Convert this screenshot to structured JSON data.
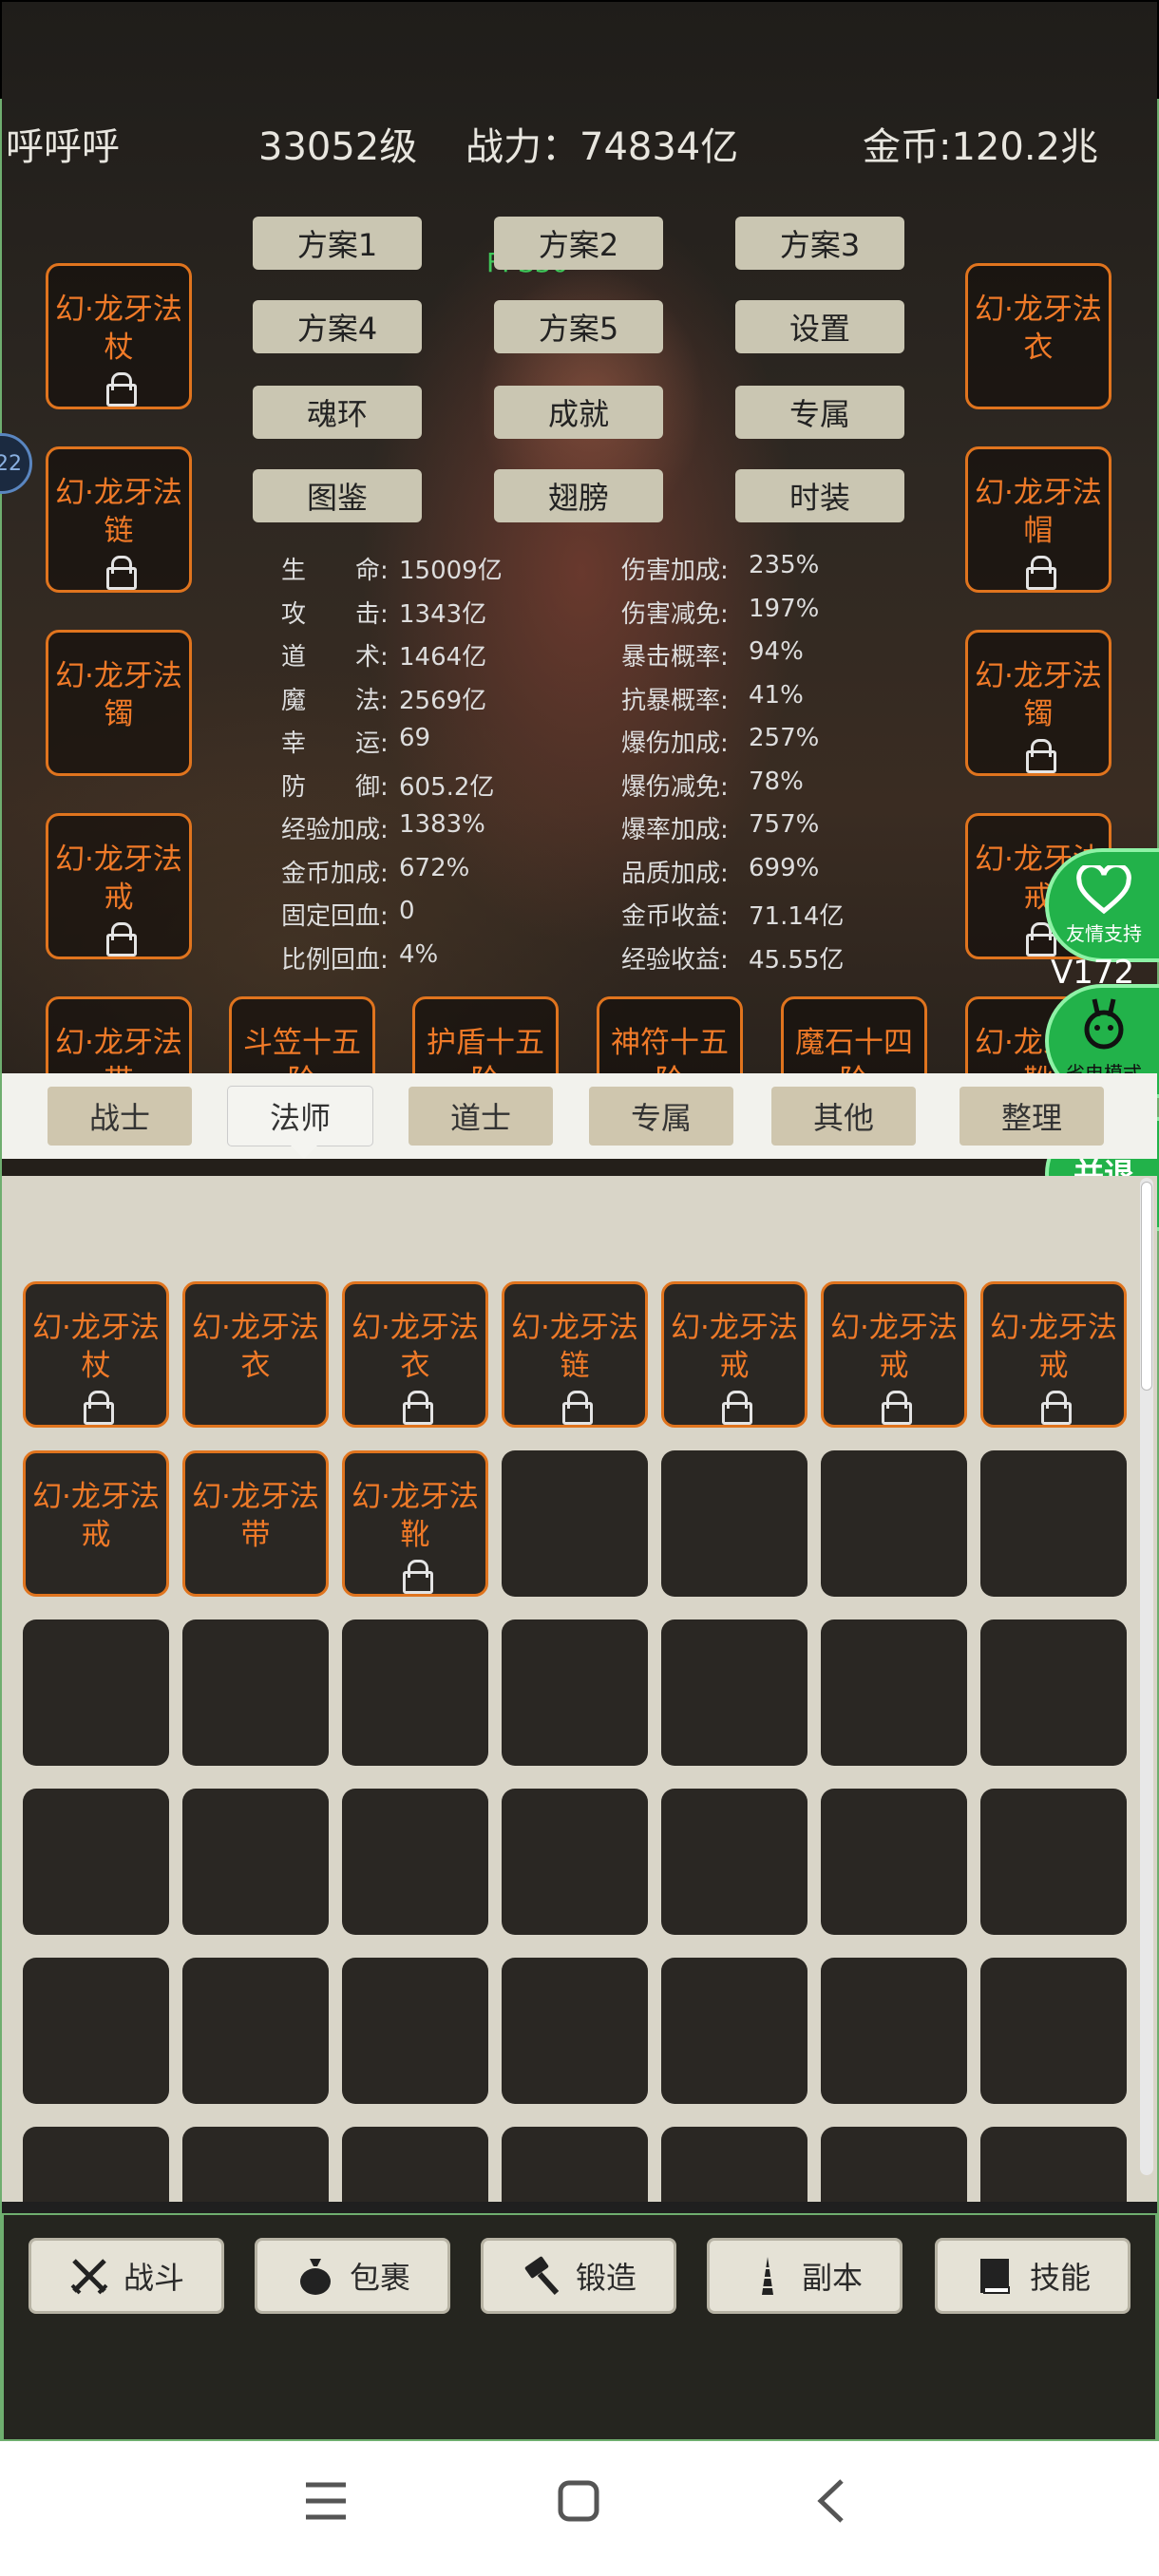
{
  "header": {
    "name": "呼呼呼",
    "level": "33052级",
    "power": "战力：74834亿",
    "gold": "金币:120.2兆"
  },
  "fps": "FPS30",
  "side_badge": "22",
  "plans": [
    "方案1",
    "方案2",
    "方案3",
    "方案4",
    "方案5",
    "设置",
    "魂环",
    "成就",
    "专属",
    "图鉴",
    "翅膀",
    "时装"
  ],
  "left_equip": [
    {
      "name": "幻·龙牙法杖",
      "locked": true
    },
    {
      "name": "幻·龙牙法链",
      "locked": true
    },
    {
      "name": "幻·龙牙法镯",
      "locked": false
    },
    {
      "name": "幻·龙牙法戒",
      "locked": true
    },
    {
      "name": "幻·龙牙法带",
      "locked": false
    }
  ],
  "right_equip": [
    {
      "name": "幻·龙牙法衣",
      "locked": false
    },
    {
      "name": "幻·龙牙法帽",
      "locked": true
    },
    {
      "name": "幻·龙牙法镯",
      "locked": true
    },
    {
      "name": "幻·龙牙法戒",
      "locked": true
    },
    {
      "name": "幻·龙牙法靴",
      "locked": true
    }
  ],
  "bottom_equip": [
    {
      "name": "斗笠十五阶",
      "locked": true
    },
    {
      "name": "护盾十五阶",
      "locked": true
    },
    {
      "name": "神符十五阶",
      "locked": true
    },
    {
      "name": "魔石十四阶",
      "locked": true
    }
  ],
  "stats_left": [
    {
      "label": "生　　命:",
      "value": "15009亿"
    },
    {
      "label": "攻　　击:",
      "value": "1343亿"
    },
    {
      "label": "道　　术:",
      "value": "1464亿"
    },
    {
      "label": "魔　　法:",
      "value": "2569亿"
    },
    {
      "label": "幸　　运:",
      "value": "69"
    },
    {
      "label": "防　　御:",
      "value": "605.2亿"
    },
    {
      "label": "经验加成:",
      "value": "1383%"
    },
    {
      "label": "金币加成:",
      "value": "672%"
    },
    {
      "label": "固定回血:",
      "value": "0"
    },
    {
      "label": "比例回血:",
      "value": "4%"
    }
  ],
  "stats_right": [
    {
      "label": "伤害加成:",
      "value": "235%"
    },
    {
      "label": "伤害减免:",
      "value": "197%"
    },
    {
      "label": "暴击概率:",
      "value": "94%"
    },
    {
      "label": "抗暴概率:",
      "value": "41%"
    },
    {
      "label": "爆伤加成:",
      "value": "257%"
    },
    {
      "label": "爆伤减免:",
      "value": "78%"
    },
    {
      "label": "爆率加成:",
      "value": "757%"
    },
    {
      "label": "品质加成:",
      "value": "699%"
    },
    {
      "label": "金币收益:",
      "value": "71.14亿"
    },
    {
      "label": "经验收益:",
      "value": "45.55亿"
    }
  ],
  "float": {
    "support": "友情支持",
    "version": "V172",
    "power_save": "省电模式",
    "save_exit": "保存并退出"
  },
  "tabs": [
    "战士",
    "法师",
    "道士",
    "专属",
    "其他",
    "整理"
  ],
  "active_tab": "法师",
  "inventory": [
    {
      "name": "幻·龙牙法杖",
      "locked": true
    },
    {
      "name": "幻·龙牙法衣",
      "locked": false
    },
    {
      "name": "幻·龙牙法衣",
      "locked": true
    },
    {
      "name": "幻·龙牙法链",
      "locked": true
    },
    {
      "name": "幻·龙牙法戒",
      "locked": true
    },
    {
      "name": "幻·龙牙法戒",
      "locked": true
    },
    {
      "name": "幻·龙牙法戒",
      "locked": true
    },
    {
      "name": "幻·龙牙法戒",
      "locked": false
    },
    {
      "name": "幻·龙牙法带",
      "locked": false
    },
    {
      "name": "幻·龙牙法靴",
      "locked": true
    }
  ],
  "inventory_slots": 42,
  "nav": [
    {
      "label": "战斗",
      "icon": "crossed-swords-icon"
    },
    {
      "label": "包裹",
      "icon": "bag-icon"
    },
    {
      "label": "锻造",
      "icon": "hammer-icon"
    },
    {
      "label": "副本",
      "icon": "tower-icon"
    },
    {
      "label": "技能",
      "icon": "book-icon"
    }
  ],
  "colors": {
    "item_border": "#e0741e",
    "item_text": "#f07a28",
    "accent_green": "#22b24a",
    "panel_border": "#6fae6f"
  }
}
